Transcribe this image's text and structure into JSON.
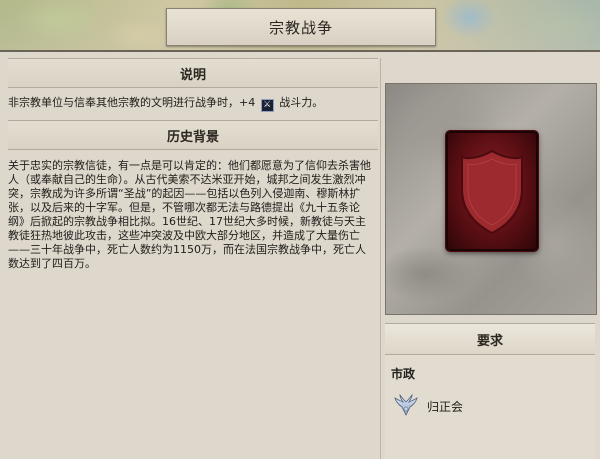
{
  "window": {
    "title": "宗教战争",
    "close_glyph": "✕"
  },
  "description": {
    "header": "说明",
    "text_before_icon": "非宗教单位与信奉其他宗教的文明进行战争时，+4 ",
    "icon_name": "combat-strength-icon",
    "text_after_icon": " 战斗力。"
  },
  "history": {
    "header": "历史背景",
    "text": "关于忠实的宗教信徒，有一点是可以肯定的：他们都愿意为了信仰去杀害他人（或奉献自己的生命）。从古代美索不达米亚开始，城邦之间发生激烈冲突，宗教成为许多所谓“圣战”的起因——包括以色列入侵迦南、穆斯林扩张，以及后来的十字军。但是，不管哪次都无法与路德提出《九十五条论纲》后掀起的宗教战争相比拟。16世纪、17世纪大多时候，新教徒与天主教徒狂热地彼此攻击，这些冲突波及中欧大部分地区，并造成了大量伤亡——三十年战争中，死亡人数约为1150万，而在法国宗教战争中，死亡人数达到了四百万。"
  },
  "card": {
    "icon_name": "shield-icon",
    "colors": {
      "card_fill": "#6b1419",
      "shield_fill": "#9c2a2f"
    }
  },
  "requirements": {
    "header": "要求",
    "category": "市政",
    "items": [
      {
        "label": "归正会",
        "icon_name": "reformed-church-wings-icon"
      }
    ]
  }
}
